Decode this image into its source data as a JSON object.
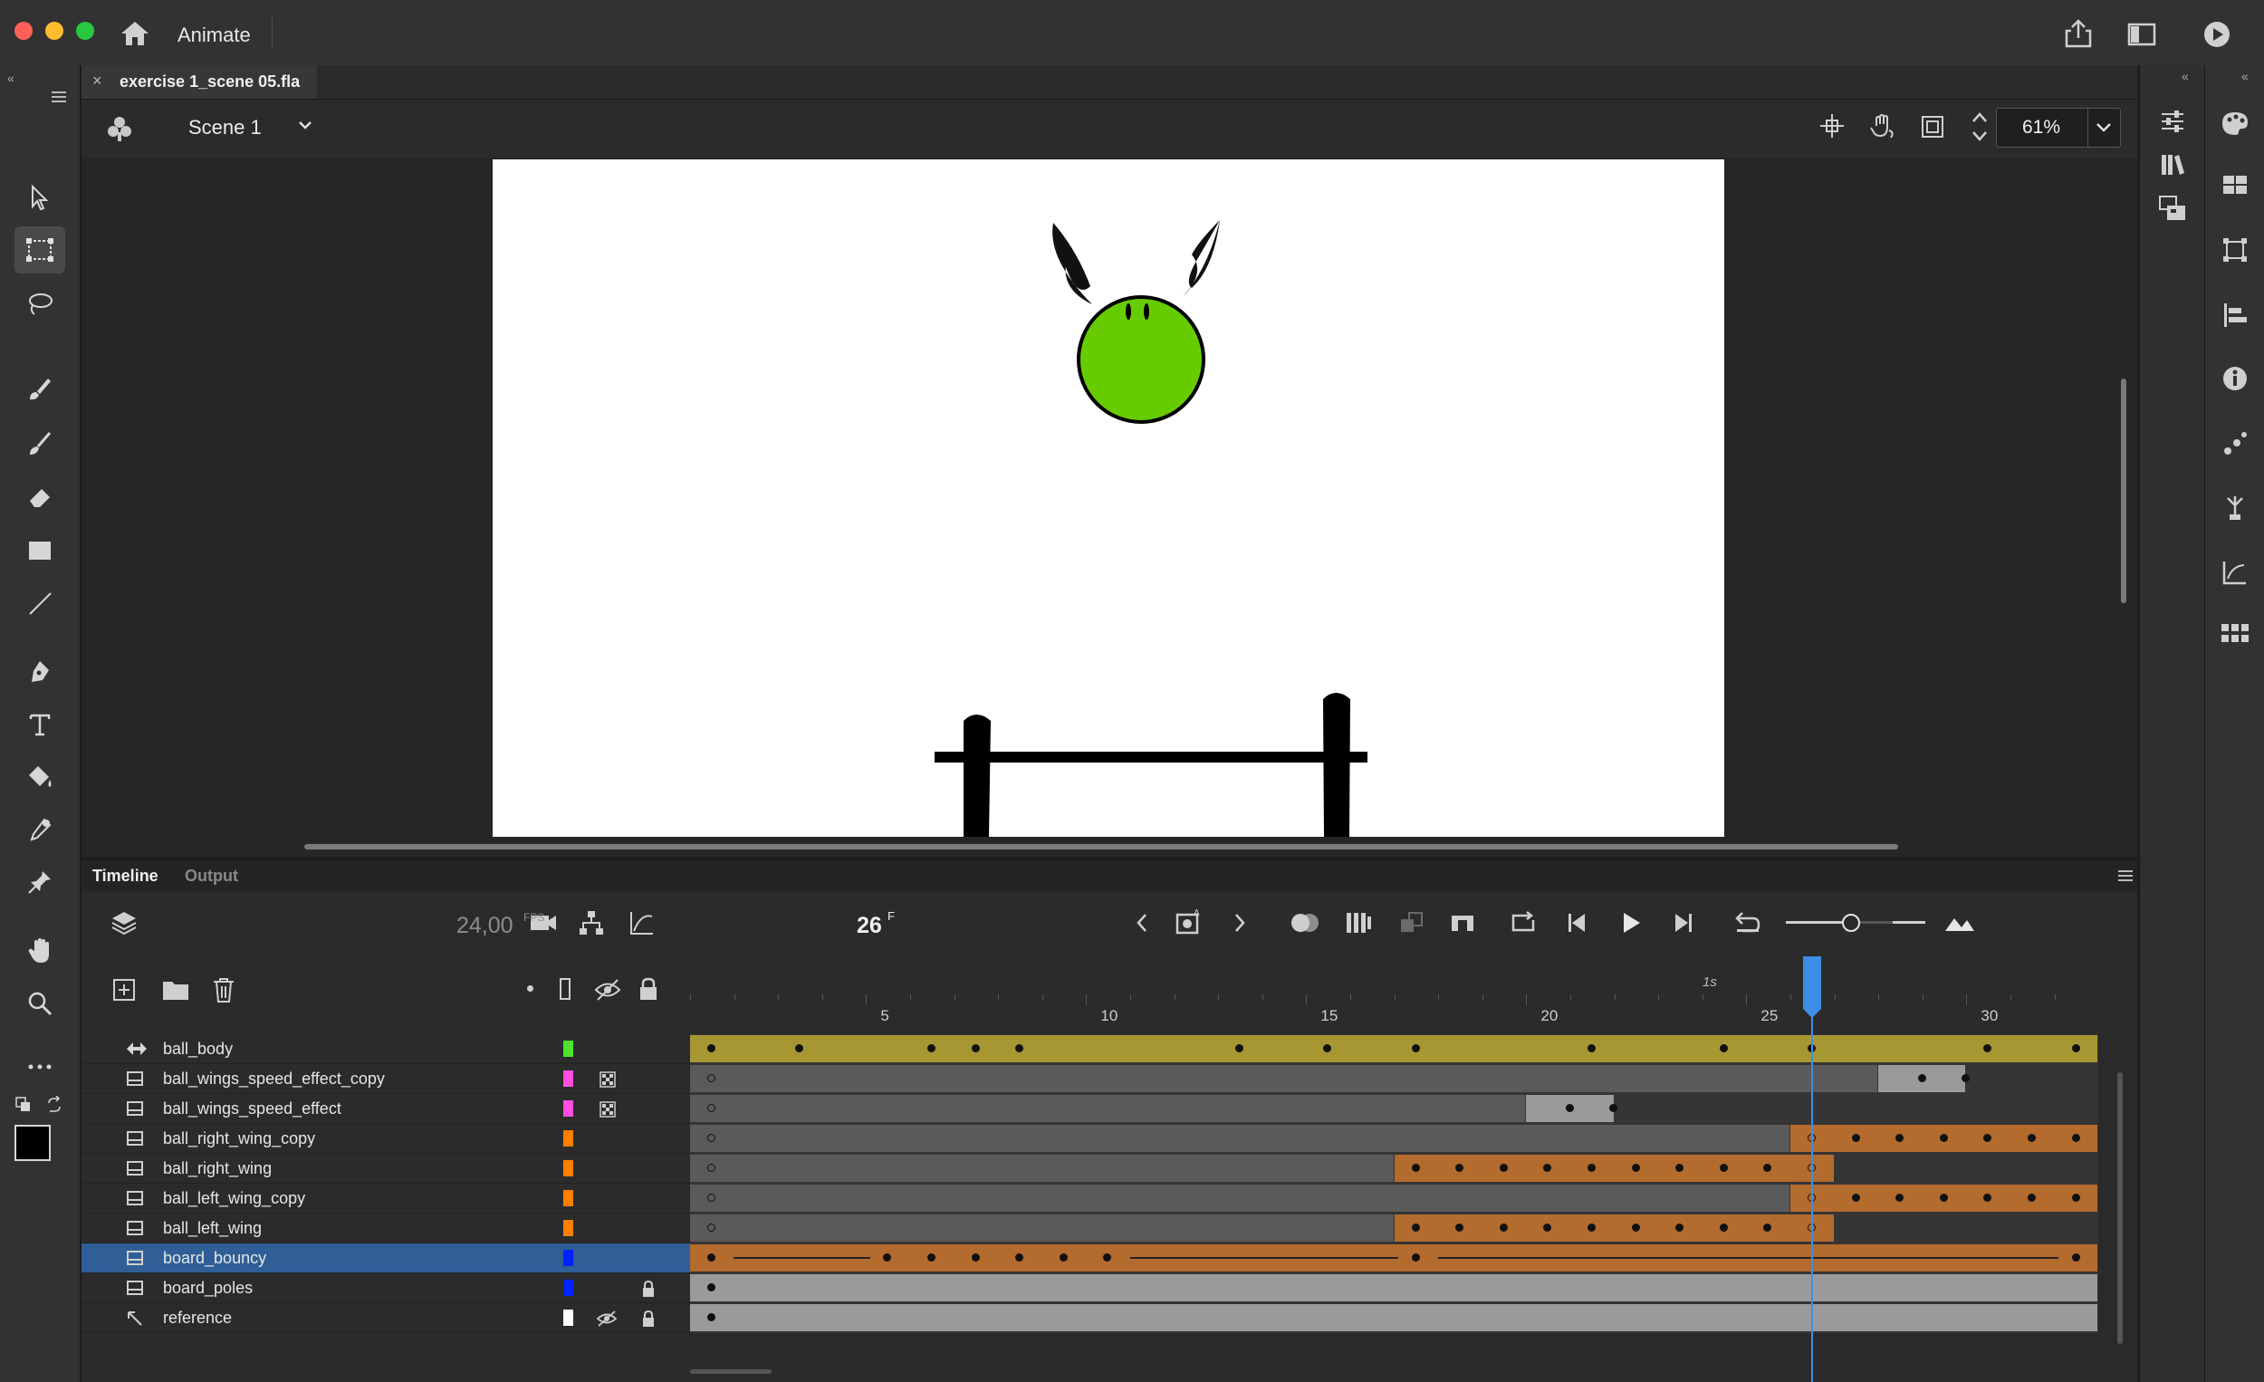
{
  "app": {
    "name": "Animate"
  },
  "document": {
    "tab_title": "exercise 1_scene 05.fla"
  },
  "editbar": {
    "scene_label": "Scene 1",
    "zoom": "61%"
  },
  "timeline": {
    "tabs": [
      "Timeline",
      "Output"
    ],
    "fps_value": "24,00",
    "fps_unit": "FPS",
    "current_frame": "26",
    "frame_unit": "F",
    "ruler_labels": [
      "5",
      "10",
      "15",
      "20",
      "25",
      "30"
    ],
    "ruler_second_marker": "1s",
    "playhead_frame": 26,
    "layers": [
      {
        "name": "ball_body",
        "color": "#4fe12b",
        "type": "tween",
        "selected": false,
        "hidden": false,
        "locked": false
      },
      {
        "name": "ball_wings_speed_effect_copy",
        "color": "#ff4fe0",
        "type": "layer",
        "selected": false,
        "hidden": false,
        "locked": false,
        "mask_icon": true
      },
      {
        "name": "ball_wings_speed_effect",
        "color": "#ff4fe0",
        "type": "layer",
        "selected": false,
        "hidden": false,
        "locked": false,
        "mask_icon": true
      },
      {
        "name": "ball_right_wing_copy",
        "color": "#ff7f00",
        "type": "layer",
        "selected": false,
        "hidden": false,
        "locked": false
      },
      {
        "name": "ball_right_wing",
        "color": "#ff7f00",
        "type": "layer",
        "selected": false,
        "hidden": false,
        "locked": false
      },
      {
        "name": "ball_left_wing_copy",
        "color": "#ff7f00",
        "type": "layer",
        "selected": false,
        "hidden": false,
        "locked": false
      },
      {
        "name": "ball_left_wing",
        "color": "#ff7f00",
        "type": "layer",
        "selected": false,
        "hidden": false,
        "locked": false
      },
      {
        "name": "board_bouncy",
        "color": "#0022ff",
        "type": "layer",
        "selected": true,
        "hidden": false,
        "locked": false
      },
      {
        "name": "board_poles",
        "color": "#0022ff",
        "type": "layer",
        "selected": false,
        "hidden": false,
        "locked": true
      },
      {
        "name": "reference",
        "color": "#ffffff",
        "type": "guide",
        "selected": false,
        "hidden": true,
        "locked": true
      }
    ]
  },
  "colors": {
    "accent_blue": "#3d8ee6",
    "tween_gold": "#a69733",
    "tween_orange": "#b36b2e",
    "ball_green": "#66cc00"
  }
}
